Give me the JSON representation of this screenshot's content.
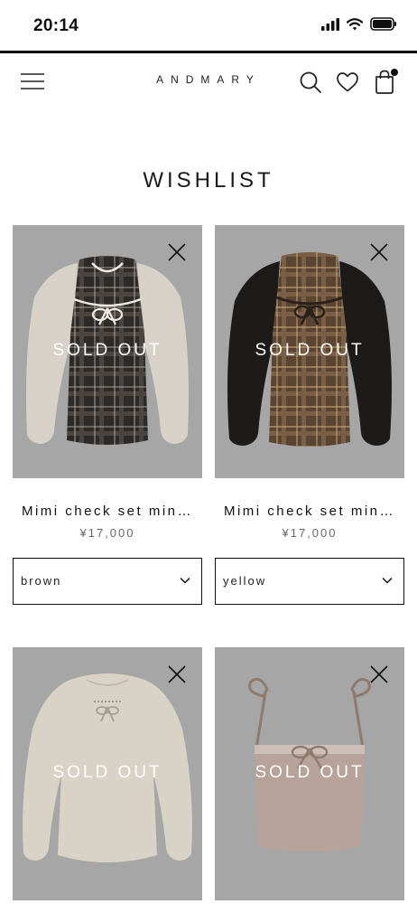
{
  "status_bar": {
    "time": "20:14"
  },
  "header": {
    "brand": "ANDMARY"
  },
  "page": {
    "title": "WISHLIST"
  },
  "products": [
    {
      "name": "Mimi check set min…",
      "price": "¥17,000",
      "status": "SOLD OUT",
      "color": "brown"
    },
    {
      "name": "Mimi check set min…",
      "price": "¥17,000",
      "status": "SOLD OUT",
      "color": "yellow"
    },
    {
      "status": "SOLD OUT"
    },
    {
      "status": "SOLD OUT"
    }
  ],
  "icons": [
    "menu-icon",
    "search-icon",
    "heart-icon",
    "bag-icon",
    "close-icon",
    "chevron-down-icon"
  ]
}
